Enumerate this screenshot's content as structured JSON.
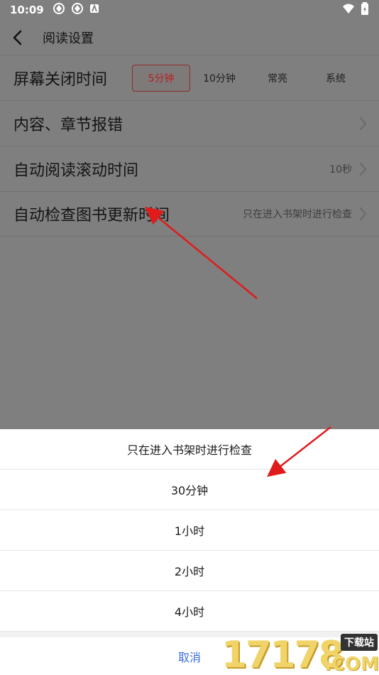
{
  "status_bar": {
    "time": "10:09"
  },
  "header": {
    "title": "阅读设置"
  },
  "settings": {
    "screen_off": {
      "label": "屏幕关闭时间",
      "options": [
        "5分钟",
        "10分钟",
        "常亮",
        "系统"
      ],
      "selected": "5分钟"
    },
    "report_error": {
      "label": "内容、章节报错"
    },
    "auto_scroll": {
      "label": "自动阅读滚动时间",
      "value": "10秒"
    },
    "update_check": {
      "label": "自动检查图书更新时间",
      "value": "只在进入书架时进行检查"
    }
  },
  "sheet": {
    "options": [
      "只在进入书架时进行检查",
      "30分钟",
      "1小时",
      "2小时",
      "4小时"
    ],
    "cancel_label": "取消"
  },
  "watermark": {
    "digits": "17178",
    "tag": "下载站",
    "domain": ".COM"
  },
  "colors": {
    "accent_red": "#b71f1f",
    "cancel_blue": "#3b6ee0",
    "arrow_red": "#e01b1b"
  }
}
